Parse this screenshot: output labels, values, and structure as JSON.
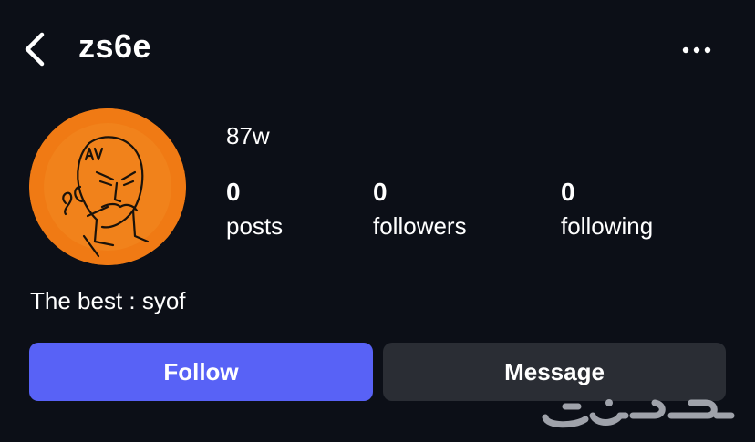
{
  "header": {
    "title": "zs6e",
    "back_icon": "chevron-left-icon",
    "more_icon": "more-horizontal-icon"
  },
  "profile": {
    "tag": "87w",
    "avatar_bg": "#f07a14",
    "stats": [
      {
        "value": "0",
        "label": "posts"
      },
      {
        "value": "0",
        "label": "followers"
      },
      {
        "value": "0",
        "label": "following"
      }
    ],
    "bio": "The best : syof"
  },
  "actions": {
    "follow_label": "Follow",
    "message_label": "Message",
    "follow_color": "#5862f6",
    "message_color": "#2a2d34"
  },
  "watermark": {
    "text": "حراج"
  }
}
